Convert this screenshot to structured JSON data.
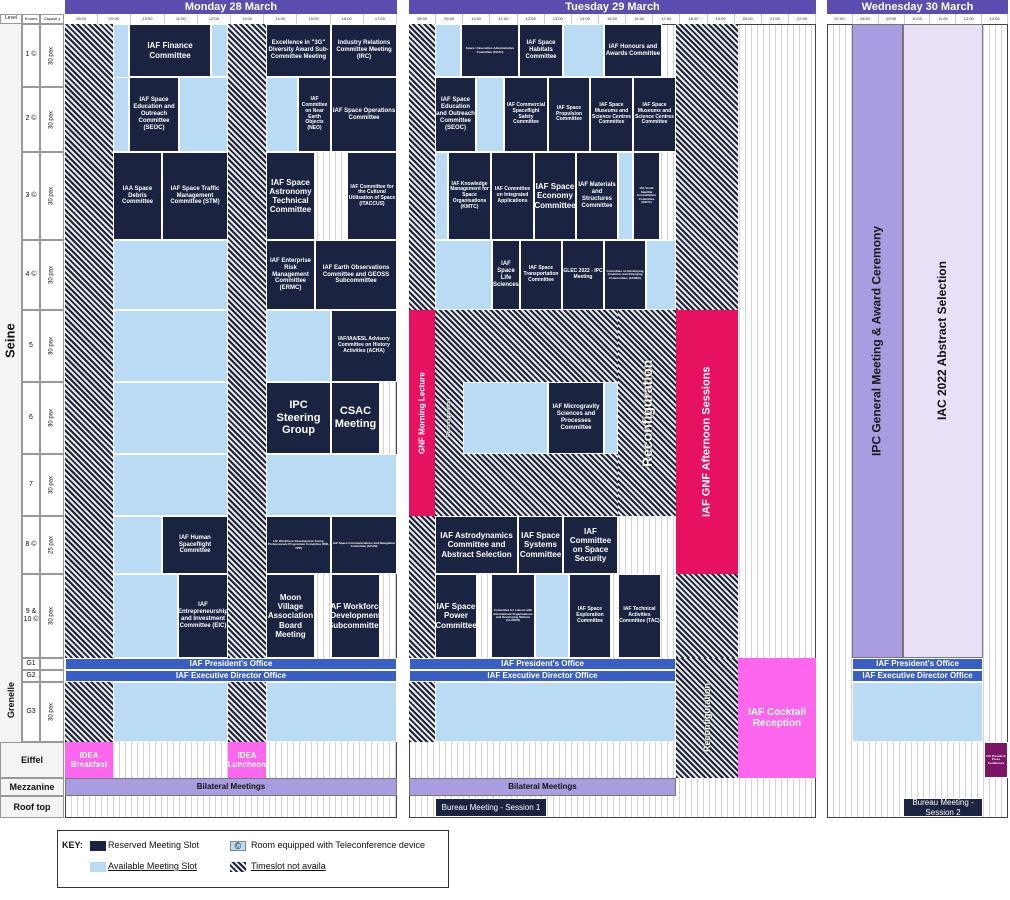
{
  "days": {
    "mon": "Monday 28 March",
    "tue": "Tuesday 29 March",
    "wed": "Wednesday 30 March"
  },
  "header": {
    "level": "Level",
    "rooms": "Rooms",
    "capacity": "Capacit y"
  },
  "times": {
    "mon": [
      "08:00",
      "09:00",
      "10:00",
      "11:00",
      "12:00",
      "13:00",
      "14:00",
      "15:00",
      "16:00",
      "17:00"
    ],
    "tue": [
      "08:00",
      "09:00",
      "10:00",
      "11:00",
      "12:00",
      "13:00",
      "14:00",
      "15:00",
      "16:00",
      "17:00",
      "18:00",
      "19:00",
      "20:00",
      "21:00",
      "22:00"
    ],
    "wed": [
      "07:00",
      "08:00",
      "09:00",
      "10:00",
      "11:00",
      "12:00",
      "13:00"
    ]
  },
  "levels": {
    "seine": "Seine",
    "grenelle": "Grenelle",
    "eiffel": "Eiffel",
    "mezzanine": "Mezzanine",
    "rooftop": "Roof top"
  },
  "rooms": [
    {
      "name": "1 ©",
      "cap": "30 pax"
    },
    {
      "name": "2 ©",
      "cap": "30 pax"
    },
    {
      "name": "3 ©",
      "cap": "30 pax"
    },
    {
      "name": "4 ©",
      "cap": "30 pax"
    },
    {
      "name": "5",
      "cap": "30 pax"
    },
    {
      "name": "6",
      "cap": "30 pax"
    },
    {
      "name": "7",
      "cap": "30 pax"
    },
    {
      "name": "8 ©",
      "cap": "25 pax"
    },
    {
      "name": "9 & 10 ©",
      "cap": "30 pax"
    },
    {
      "name": "G1",
      "cap": ""
    },
    {
      "name": "G2",
      "cap": ""
    },
    {
      "name": "G3",
      "cap": "30 pax"
    }
  ],
  "mon": {
    "r1a": "IAF Finance Committee",
    "r1b": "Excellence in \"3G\" Diversity Award Sub-Committee Meeting",
    "r1c": "Industry Relations Committee Meeting (IRC)",
    "r2a": "IAF Space Education and Outreach Committee (SEOC)",
    "r2b": "IAF Committee on Near Earth Objects (NEO)",
    "r2c": "IAF Space Operations Committee",
    "r3a": "IAA Space Debris Committee",
    "r3b": "IAF Space Traffic Management Committee (STM)",
    "r3c": "IAF Space Astronomy Technical Committee",
    "r3d": "IAF Committee for the Cultural Utilisation of Space (ITACCUS)",
    "r4a": "IAF Enterprise Risk Management Committee (ERMC)",
    "r4b": "IAF Earth Observations Committee and GEOSS Subcommittee",
    "r5a": "IAF/IAA/ESL Advisory Committee on History Activities (ACHA)",
    "r6a": "IPC Steering Group",
    "r6b": "CSAC Meeting",
    "r8a": "IAF Human Spaceflight Committee",
    "r8b": "IAF Workforce Development-Young Professionals Programme Committee (WD-YPP)",
    "r8c": "IAF Space Communications and Navigation Committee (SCAN)",
    "r9a": "IAF Entrepreneurship and Investment Committee (EIC)",
    "r9b": "Moon Village Association Board Meeting",
    "r9c": "IAF Workforce Development Subcommittee",
    "president": "IAF President's Office",
    "exec": "IAF Executive Director Office",
    "breakfast": "IDEA Breakfast",
    "luncheon": "IDEA Luncheon",
    "bilateral": "Bilateral Meetings"
  },
  "tue": {
    "r1a": "Space Universities Administrative Committee (SUAC)",
    "r1b": "IAF Space Habitats Committee",
    "r1c": "IAF Honours and Awards Committee",
    "r2a": "IAF Space Education and Outreach Committee (SEOC)",
    "r2b": "IAF Commercial Spaceflight Safety Committee",
    "r2c": "IAF Space Propulsion Committee",
    "r2d": "IAF Space Museums and Science Centres Committee",
    "r2e": "IAF Space Museums and Science Centres Committee",
    "r3a": "IAF Knowledge Management for Space Organisations (KMTC)",
    "r3b": "IAF Committee on Integrated Applications",
    "r3c": "IAF Space Economy Committee",
    "r3d": "IAF Materials and Structures Committee",
    "r3e": "IAF Small Satellite Constellation Committee (SSCC)",
    "r4a": "IAF Space Life Sciences",
    "r4b": "IAF Space Transportation Committee",
    "r4c": "GLEC 2022 - IPC Meeting",
    "r4d": "Committee on Developing Countries and Emerging Communities (ACDEC)",
    "gnfMorning": "GNF Morning Lecture",
    "gnfAfternoon": "IAF GNF Afternoon Sessions",
    "reconfig": "Reconfiguration",
    "reconfigSmall": "Reconfiguration",
    "reconfigG": "Reconfiguration",
    "r6a": "IAF Microgravity Sciences and Processes Committee",
    "r8a": "IAF Astrodynamics Committee and Abstract Selection",
    "r8b": "IAF Space Systems Committee",
    "r8c": "IAF Committee on Space Security",
    "r9a": "IAF Space Power Committee",
    "r9b": "Committee for Liaison with International Organisations and Developing Nations (CLIODN)",
    "r9c": "IAF Space Exploration Committee",
    "r9d": "IAF Technical Activities Committee (TAC)",
    "president": "IAF President's Office",
    "exec": "IAF Executive Director Office",
    "cocktail": "IAF Cocktail Reception",
    "bilateral": "Bilateral Meetings",
    "bureau": "Bureau Meeting - Session 1"
  },
  "wed": {
    "ipc": "IPC General Meeting & Award Ceremony",
    "abstract": "IAC 2022 Abstract Selection",
    "president": "IAF President's Office",
    "exec": "IAF Executive Director Office",
    "press": "IAF President Press Conference",
    "bureau": "Bureau Meeting - Session 2"
  },
  "key": {
    "title": "KEY:",
    "reserved": "Reserved Meeting Slot",
    "available": "Available Meeting Slot",
    "tele": "Room equipped with Teleconference device",
    "teleSymbol": "©",
    "na": "Timeslot not availa"
  },
  "colors": {
    "reserved": "#1a2340",
    "available": "#b9dcf4",
    "office": "#3a5fc4",
    "gnf": "#e6125f",
    "reception": "#ff66ee",
    "dayHeader": "#5b4db0"
  }
}
